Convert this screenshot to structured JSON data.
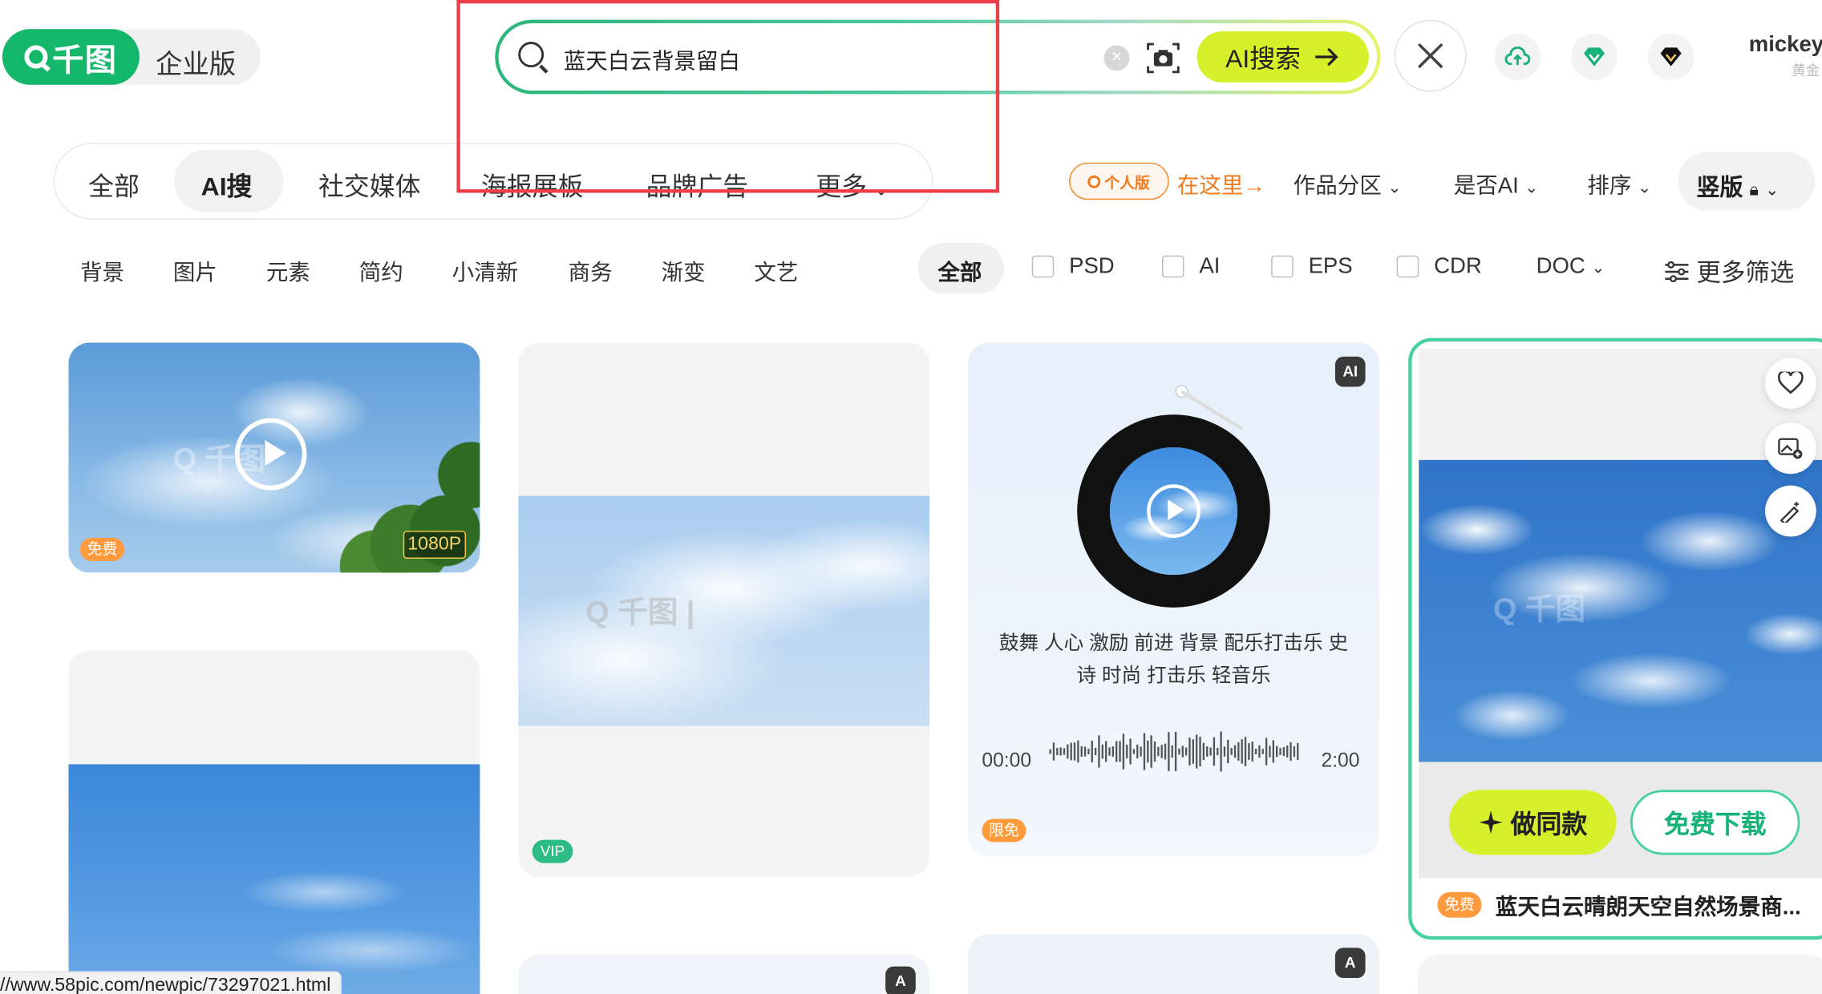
{
  "header": {
    "logo_text": "千图",
    "enterprise_label": "企业版",
    "search_value": "蓝天白云背景留白",
    "ai_search_label": "AI搜索",
    "user_name": "mickey",
    "user_sub": "黄金"
  },
  "tabs": [
    "全部",
    "AI搜",
    "社交媒体",
    "海报展板",
    "品牌广告",
    "更多"
  ],
  "filters": {
    "personal_pill": "个人版",
    "here_link": "在这里→",
    "dropdowns": [
      "作品分区",
      "是否AI",
      "排序"
    ],
    "vertical_label": "竖版"
  },
  "chips": [
    "背景",
    "图片",
    "元素",
    "简约",
    "小清新",
    "商务",
    "渐变",
    "文艺"
  ],
  "formats": {
    "all_label": "全部",
    "items": [
      "PSD",
      "AI",
      "EPS",
      "CDR"
    ],
    "doc_label": "DOC",
    "more_filter": "更多筛选"
  },
  "cards": {
    "video": {
      "free_badge": "免费",
      "res_badge": "1080P"
    },
    "image2": {
      "vip_badge": "VIP"
    },
    "music": {
      "tags_line1": "鼓舞 人心 激励 前进 背景 配乐打击乐 史",
      "tags_line2": "诗 时尚 打击乐 轻音乐",
      "time_start": "00:00",
      "time_end": "2:00",
      "limited_badge": "限免",
      "ai_badge": "AI"
    },
    "hover": {
      "do_same": "做同款",
      "free_download": "免费下载",
      "title_badge": "免费",
      "title": "蓝天白云晴朗天空自然场景商..."
    }
  },
  "status_url": "//www.58pic.com/newpic/73297021.html",
  "colors": {
    "brand_green": "#14b86a",
    "accent_lime": "#d6f02c",
    "highlight_red": "#ee3e4a",
    "orange": "#f07a1e"
  }
}
